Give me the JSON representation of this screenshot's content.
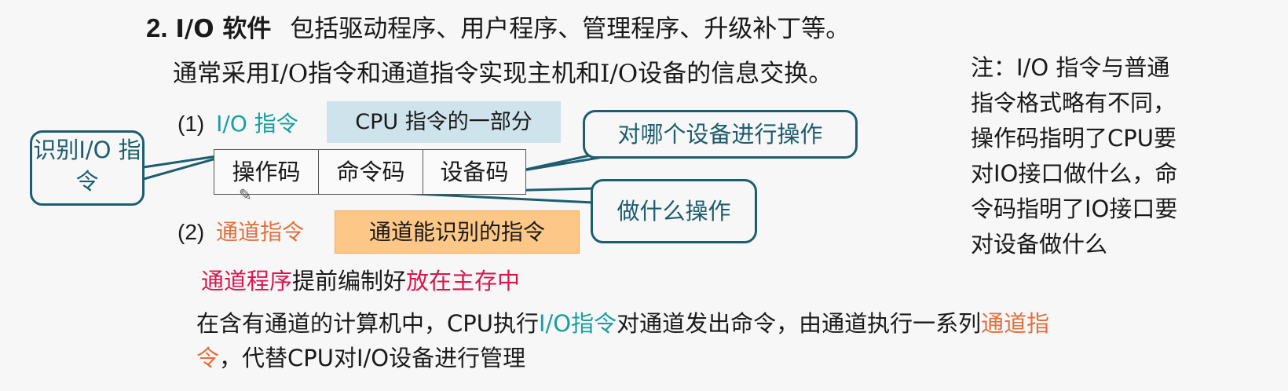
{
  "heading": {
    "number": "2.",
    "title": "I/O 软件",
    "desc": "包括驱动程序、用户程序、管理程序、升级补丁等。"
  },
  "intro": "通常采用I/O指令和通道指令实现主机和I/O设备的信息交换。",
  "io_instruction": {
    "index": "(1)",
    "label": "I/O 指令",
    "box_text": "CPU 指令的一部分"
  },
  "format_fields": [
    "操作码",
    "命令码",
    "设备码"
  ],
  "callouts": {
    "identify": "识别I/O 指令",
    "which_device": "对哪个设备进行操作",
    "what_op": "做什么操作"
  },
  "channel_instruction": {
    "index": "(2)",
    "label": "通道指令",
    "box_text": "通道能识别的指令"
  },
  "channel_program": {
    "part1": "通道程序",
    "part2": "提前编制好",
    "part3": "放在主存中"
  },
  "paragraph": {
    "p1": "在含有通道的计算机中，CPU执行",
    "p2": "I/O指令",
    "p3": "对通道发出命令，由通道执行一系列",
    "p4": "通道指令",
    "p5": "，代替CPU对I/O设备进行管理"
  },
  "note": [
    "注：I/O 指令与普通",
    "指令格式略有不同，",
    "操作码指明了CPU要",
    "对IO接口做什么，命",
    "令码指明了IO接口要",
    "对设备做什么"
  ],
  "colors": {
    "teal": "#1a9fa0",
    "orange": "#e0713f",
    "crimson": "#d8164e",
    "callout": "#1d5d6f",
    "blue_box": "#cfe3ec",
    "orange_box": "#fdc787"
  },
  "icons": {
    "pen": "pencil-cursor-icon"
  }
}
